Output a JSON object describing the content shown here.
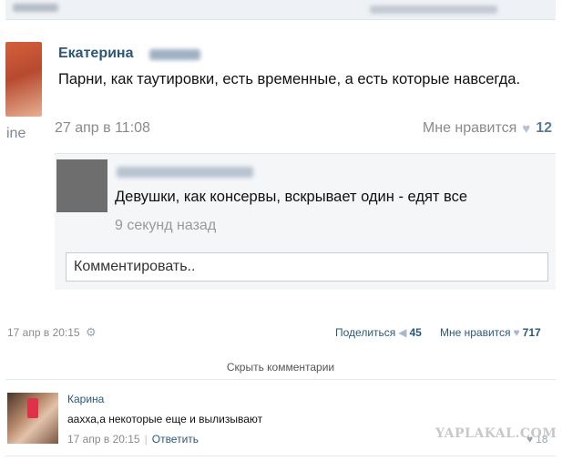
{
  "screenshot_post": {
    "author_first": "Екатерина",
    "text": "Парни, как таутировки, есть временные, а есть которые навсегда.",
    "date": "27 апр в 11:08",
    "like_label": "Мне нравится",
    "like_count": "12",
    "left_edge_fragment": "ine",
    "reply": {
      "text": "Девушки, как консервы, вскрывает один - едят все",
      "time": "9 секунд назад"
    },
    "comment_placeholder": "Комментировать.."
  },
  "outer_post": {
    "date": "17 апр в 20:15",
    "share_label": "Поделиться",
    "share_count": "45",
    "like_label": "Мне нравится",
    "like_count": "717",
    "hide_comments": "Скрыть комментарии"
  },
  "comment": {
    "author": "Карина",
    "text": "аахха,а некоторые еще и вылизывают",
    "time": "17 апр в 20:15",
    "reply_label": "Ответить",
    "like_count": "18"
  },
  "watermark": "YAPLAKAL.COM",
  "icons": {
    "gear": "gear-icon",
    "heart": "heart-icon",
    "megaphone": "megaphone-icon"
  }
}
